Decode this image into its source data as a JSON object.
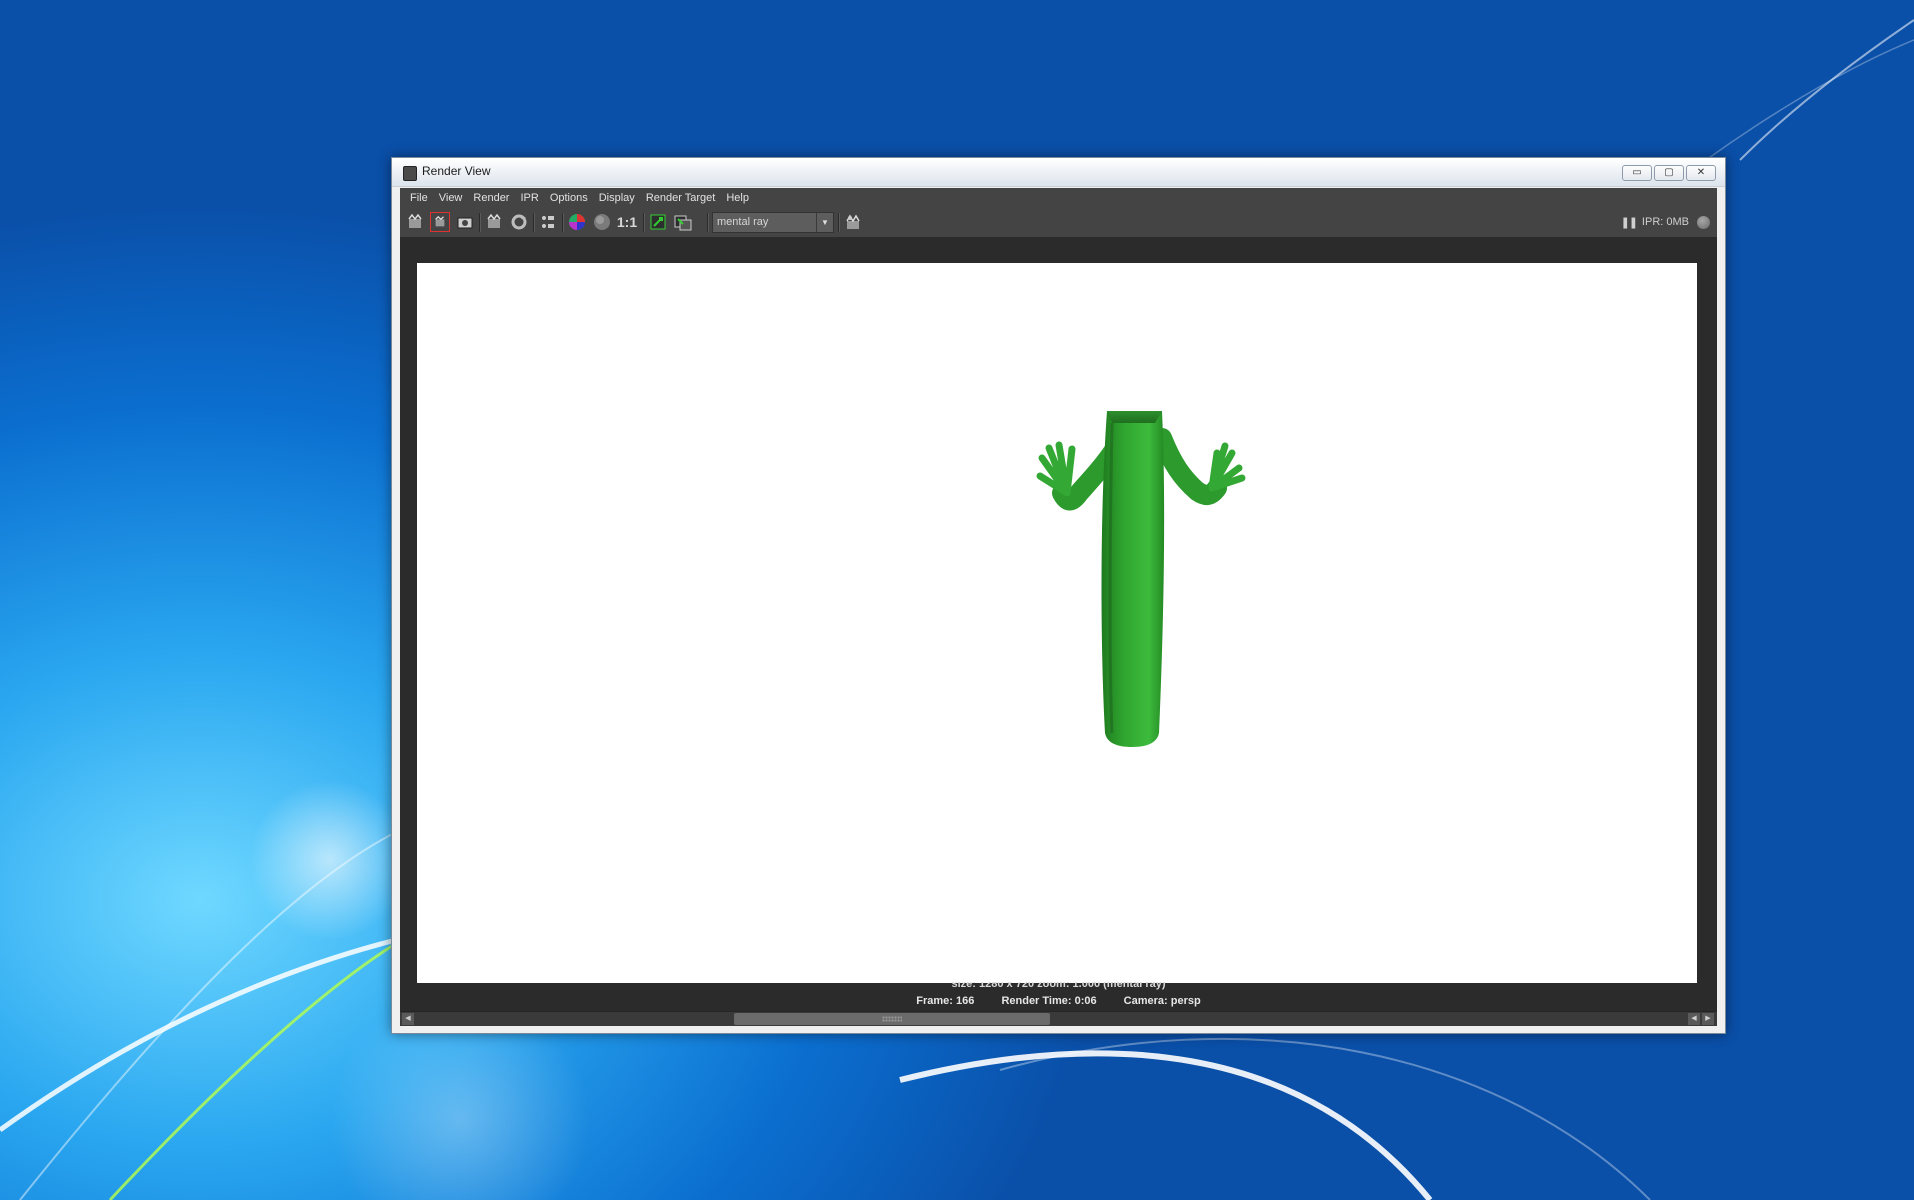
{
  "window": {
    "title": "Render View",
    "caption_buttons": {
      "minimize": "▭",
      "maximize": "▢",
      "close": "✕"
    }
  },
  "menubar": [
    "File",
    "View",
    "Render",
    "IPR",
    "Options",
    "Display",
    "Render Target",
    "Help"
  ],
  "toolbar": {
    "buttons": [
      {
        "name": "redo-previous-render-icon"
      },
      {
        "name": "render-region-icon"
      },
      {
        "name": "snapshot-icon"
      },
      {
        "name": "ipr-render-icon"
      },
      {
        "name": "refresh-ipr-icon"
      },
      {
        "name": "render-settings-icon"
      },
      {
        "name": "color-channels-icon"
      },
      {
        "name": "alpha-channel-icon"
      },
      {
        "name": "real-size-icon",
        "label": "1:1"
      },
      {
        "name": "keep-image-icon"
      },
      {
        "name": "remove-image-icon"
      }
    ],
    "renderer": "mental ray",
    "ipr_pause": "❚❚",
    "ipr_memory": "IPR: 0MB"
  },
  "render_info": {
    "line1": "size: 1280 x 720 zoom: 1.000      (mental ray)",
    "frame": "Frame: 166",
    "render_time": "Render Time: 0:06",
    "camera": "Camera: persp"
  },
  "colors": {
    "panel_bg": "#444444",
    "viewport_bg": "#2b2b2b",
    "character_green": "#2e9e2e"
  }
}
